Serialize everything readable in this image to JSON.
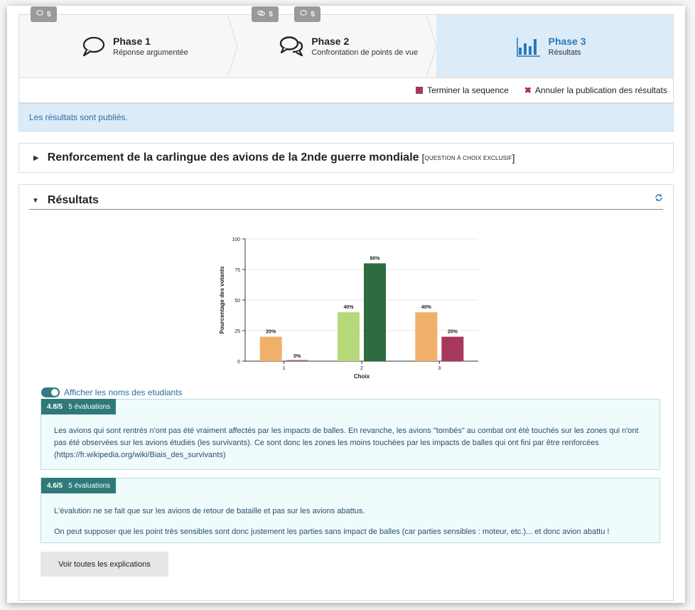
{
  "phases": [
    {
      "badges": [
        "5"
      ],
      "title": "Phase 1",
      "subtitle": "Réponse argumentée",
      "icon": "speech-bubble-icon"
    },
    {
      "badges": [
        "5",
        "5"
      ],
      "title": "Phase 2",
      "subtitle": "Confrontation de points de vue",
      "icon": "two-speech-bubbles-icon"
    },
    {
      "badges": [],
      "title": "Phase 3",
      "subtitle": "Résultats",
      "icon": "bar-chart-icon",
      "active": true
    }
  ],
  "actions": {
    "finish": "Terminer la sequence",
    "unpublish": "Annuler la publication des résultats"
  },
  "notice": "Les résultats sont publiés.",
  "question": {
    "title": "Renforcement de la carlingue des avions de la 2nde guerre mondiale",
    "open": "[",
    "tag": "QUESTION À CHOIX EXCLUSIF",
    "close": "]"
  },
  "results": {
    "title": "Résultats",
    "toggle_label": "Afficher les noms des etudiants",
    "button": "Voir toutes les explications"
  },
  "chart_data": {
    "type": "bar",
    "categories": [
      "1",
      "2",
      "3"
    ],
    "series": [
      {
        "values": [
          20,
          40,
          40
        ],
        "colors": [
          "#f0b06c",
          "#b5d97a",
          "#f0b06c"
        ]
      },
      {
        "values": [
          0,
          80,
          20
        ],
        "colors": [
          "#b0335e",
          "#2e6b3e",
          "#a6385c"
        ]
      }
    ],
    "data_labels": [
      [
        "20%",
        "40%",
        "40%"
      ],
      [
        "0%",
        "80%",
        "20%"
      ]
    ],
    "xlabel": "Choix",
    "ylabel": "Pourcentage des votants",
    "ylim": [
      0,
      100
    ],
    "yticks": [
      "0",
      "25",
      "50",
      "75",
      "100"
    ],
    "grid": true
  },
  "explanations": [
    {
      "score": "4.8/5",
      "count": "5 évaluations",
      "paragraphs": [
        "Les avions qui sont rentrés n'ont pas été vraiment affectés par les impacts de balles. En revanche, les avions \"tombés\" au combat ont été touchés sur les zones qui n'ont pas été observées sur les avions étudiés (les survivants). Ce sont donc les zones les moins touchées par les impacts de balles qui ont fini par être  renforcées (https://fr.wikipedia.org/wiki/Biais_des_survivants)"
      ]
    },
    {
      "score": "4.6/5",
      "count": "5 évaluations",
      "paragraphs": [
        "L'évalution ne se fait que sur les avions de retour de bataille et pas sur les avions abattus.",
        "On peut supposer que les point très sensibles sont donc justement les parties sans impact de balles (car parties sensibles : moteur, etc.)... et donc avion abattu !"
      ]
    }
  ]
}
